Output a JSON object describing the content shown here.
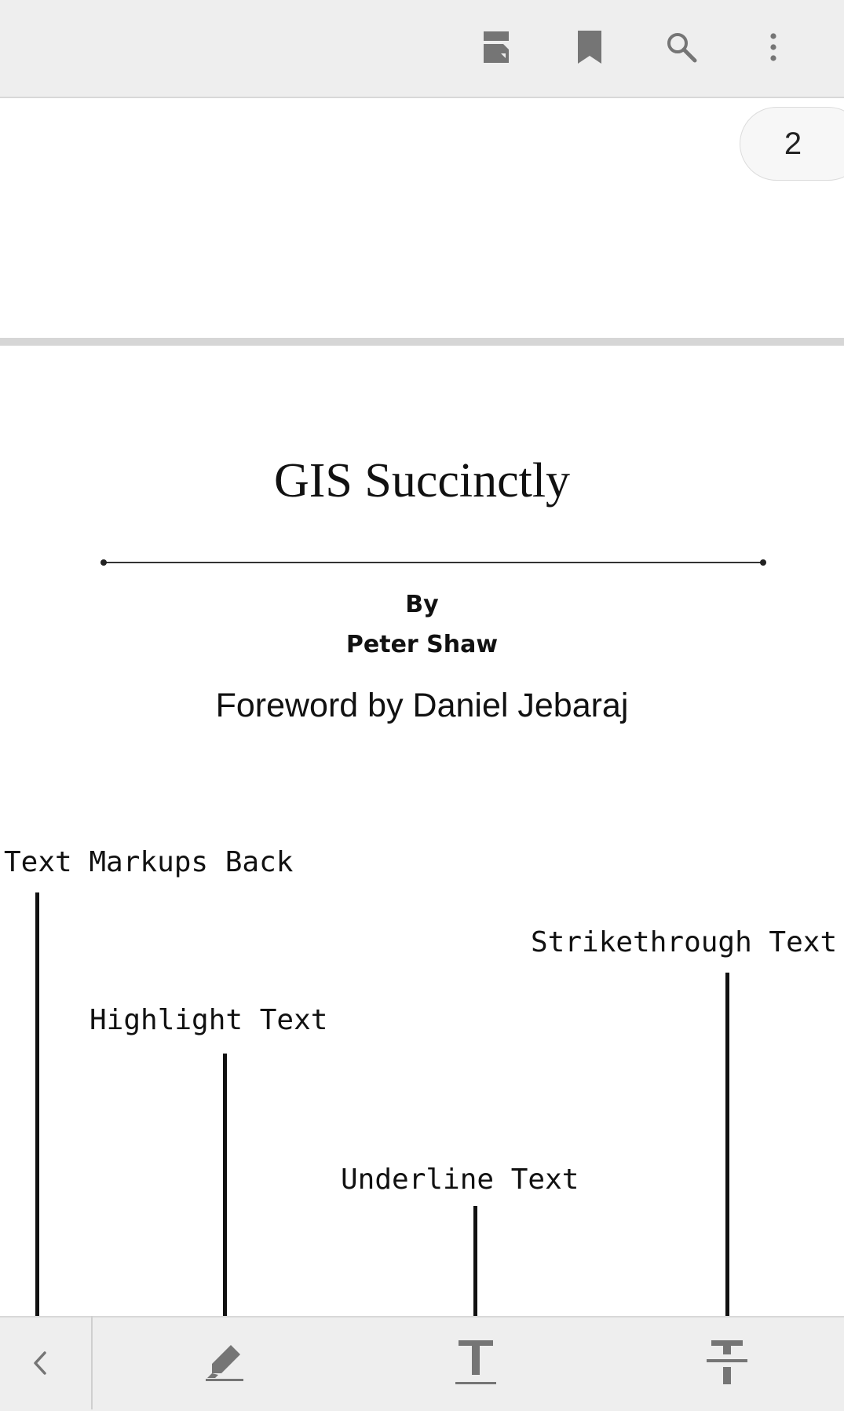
{
  "toolbar": {
    "icons": [
      "bookmark-pane-icon",
      "bookmark-icon",
      "search-icon",
      "more-vert-icon"
    ]
  },
  "page_indicator": {
    "current_page": "2"
  },
  "document": {
    "title": "GIS Succinctly",
    "by_label": "By",
    "author": "Peter Shaw",
    "foreword": "Foreword by Daniel Jebaraj"
  },
  "callouts": {
    "back": "Text Markups Back",
    "strikethrough": "Strikethrough Text",
    "highlight": "Highlight Text",
    "underline": "Underline Text"
  },
  "markup_bar": {
    "icons": [
      "back-chevron-icon",
      "highlight-pen-icon",
      "underline-icon",
      "strikethrough-icon"
    ]
  },
  "colors": {
    "bar_background": "#eeeeee",
    "icon_gray": "#757575",
    "separator": "#d6d6d6"
  }
}
